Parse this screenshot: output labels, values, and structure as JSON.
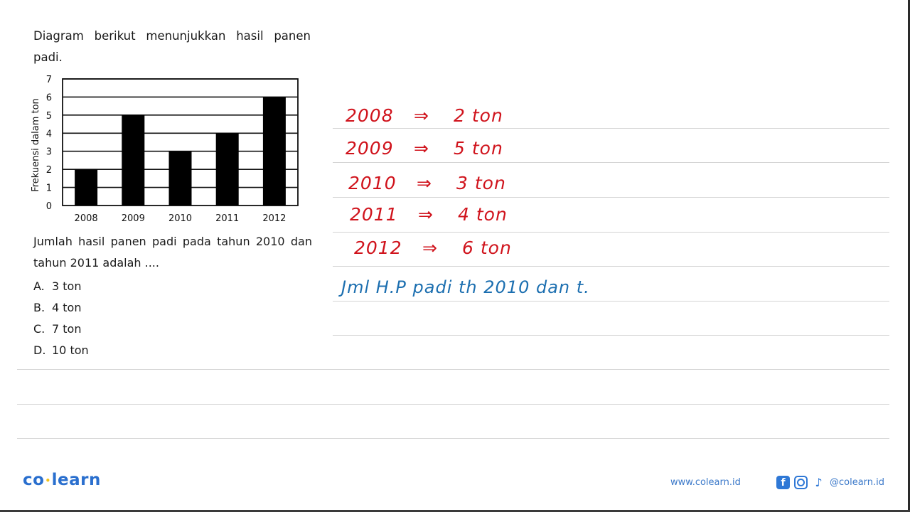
{
  "question": {
    "intro": "Diagram berikut menunjukkan hasil panen padi.",
    "text": "Jumlah hasil panen padi pada tahun 2010 dan tahun 2011 adalah ....",
    "options": [
      {
        "letter": "A.",
        "text": "3 ton"
      },
      {
        "letter": "B.",
        "text": "4 ton"
      },
      {
        "letter": "C.",
        "text": "7 ton"
      },
      {
        "letter": "D.",
        "text": "10 ton"
      }
    ]
  },
  "chart_data": {
    "type": "bar",
    "title": "",
    "categories": [
      "2008",
      "2009",
      "2010",
      "2011",
      "2012"
    ],
    "values": [
      2,
      5,
      3,
      4,
      6
    ],
    "xlabel": "",
    "ylabel": "Frekuensi dalam ton",
    "ylim": [
      0,
      7
    ],
    "yticks": [
      0,
      1,
      2,
      3,
      4,
      5,
      6,
      7
    ],
    "grid": true,
    "bar_color": "#000000"
  },
  "handwriting": {
    "rows": [
      {
        "year": "2008",
        "arrow": "⇒",
        "value": "2 ton"
      },
      {
        "year": "2009",
        "arrow": "⇒",
        "value": "5 ton"
      },
      {
        "year": "2010",
        "arrow": "⇒",
        "value": "3 ton"
      },
      {
        "year": "2011",
        "arrow": "⇒",
        "value": "4 ton"
      },
      {
        "year": "2012",
        "arrow": "⇒",
        "value": "6 ton"
      }
    ],
    "note": "Jml H.P padi th 2010 dan t.",
    "colors": {
      "values": "#d0131c",
      "note": "#1c6fb0"
    }
  },
  "footer": {
    "logo_left": "co",
    "logo_dot": "•",
    "logo_right": "learn",
    "website": "www.colearn.id",
    "social_handle": "@colearn.id",
    "icons": [
      "facebook-icon",
      "instagram-icon",
      "tiktok-icon"
    ],
    "brand_color": "#2a6fce"
  }
}
